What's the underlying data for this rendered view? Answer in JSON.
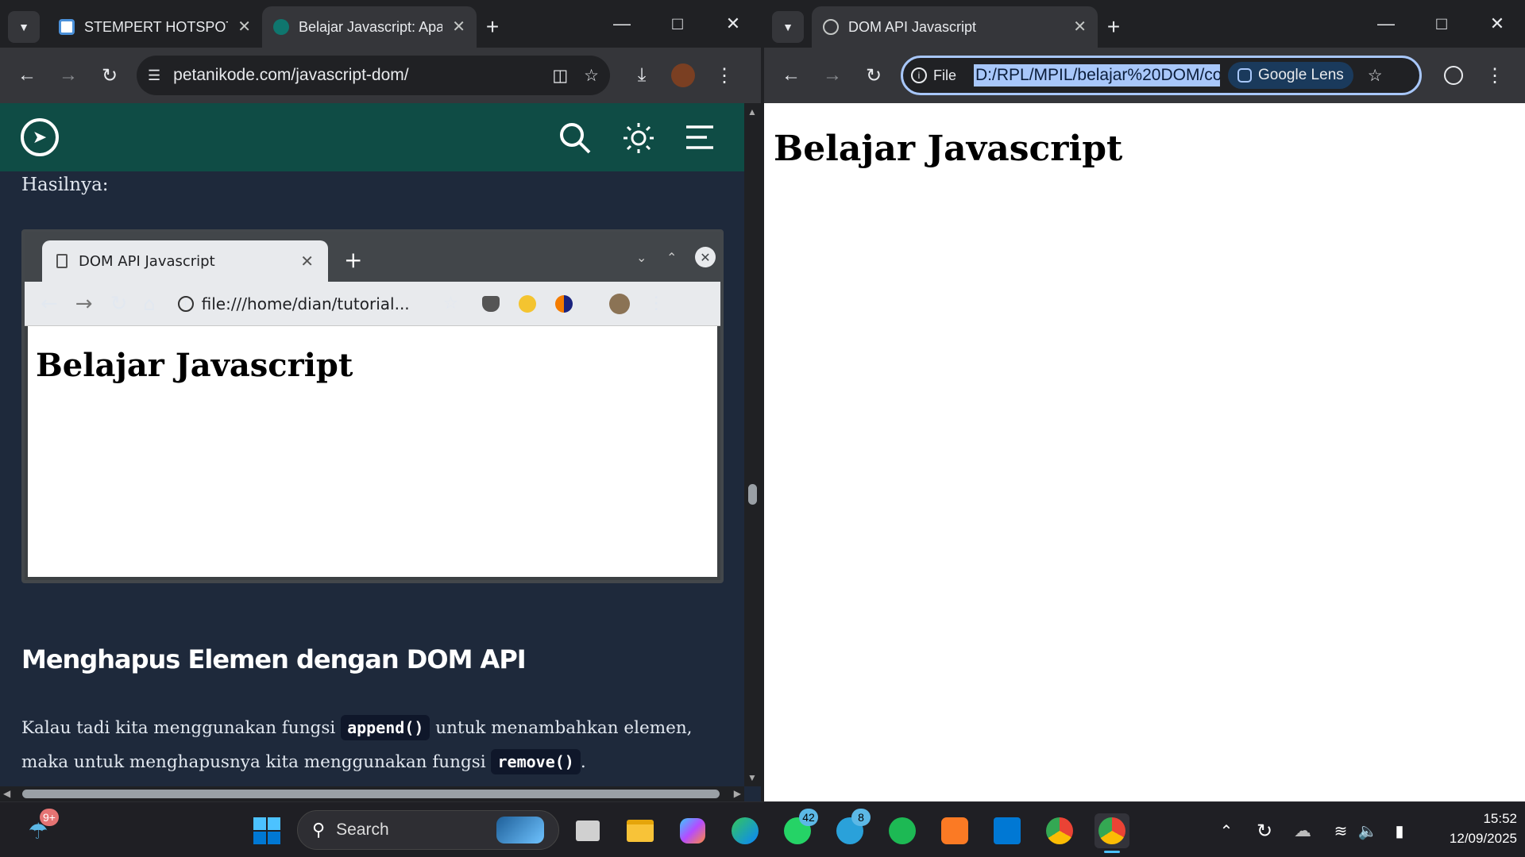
{
  "left_browser": {
    "tabs": [
      {
        "label": "STEMPERT HOTSPOT",
        "icon": "card-icon",
        "active": false
      },
      {
        "label": "Belajar Javascript: Apa",
        "icon": "petanikode-icon",
        "active": true
      }
    ],
    "url": "petanikode.com/javascript-dom/",
    "page": {
      "intro": "Hasilnya:",
      "mockup": {
        "tab_title": "DOM API Javascript",
        "url": "file:///home/dian/tutorial...",
        "heading": "Belajar Javascript"
      },
      "section_heading": "Menghapus Elemen dengan DOM API",
      "paragraph": {
        "part1": "Kalau tadi kita menggunakan fungsi ",
        "code1": "append()",
        "part2": " untuk menambahkan elemen, maka untuk menghapusnya kita menggunakan fungsi ",
        "code2": "remove()",
        "part3": "."
      }
    }
  },
  "right_browser": {
    "tab": {
      "label": "DOM API Javascript",
      "icon": "globe-icon"
    },
    "site_info": "File",
    "url": "D:/RPL/MPIL/belajar%20DOM/co",
    "lens_label": "Google Lens",
    "page_heading": "Belajar Javascript"
  },
  "taskbar": {
    "weather_badge": "9+",
    "search_placeholder": "Search",
    "whatsapp_badge": "42",
    "telegram_badge": "8",
    "time": "15:52",
    "date": "12/09/2025"
  }
}
